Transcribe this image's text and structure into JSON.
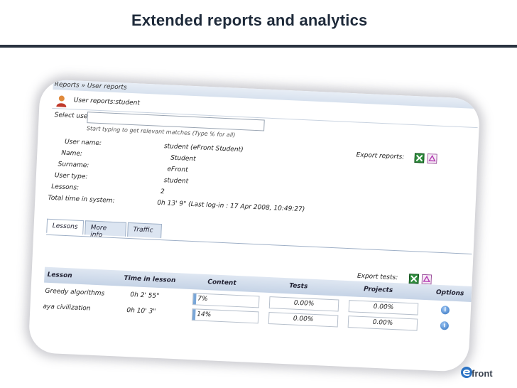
{
  "slide": {
    "title": "Extended reports and analytics"
  },
  "crumb": "Reports » User reports",
  "heading": "User reports:student",
  "select_user": {
    "label": "Select user:",
    "placeholder": "",
    "hint": "Start typing to get relevant matches (Type % for all)"
  },
  "export_reports_label": "Export reports:",
  "info": [
    {
      "label": "User name:",
      "value": "student (eFront Student)"
    },
    {
      "label": "Name:",
      "value": "Student"
    },
    {
      "label": "Surname:",
      "value": "eFront"
    },
    {
      "label": "User type:",
      "value": "student"
    },
    {
      "label": "Lessons:",
      "value": "2"
    },
    {
      "label": "Total time in system:",
      "value": "0h 13' 9\" (Last log-in : 17 Apr 2008, 10:49:27)"
    }
  ],
  "tabs": [
    "Lessons",
    "More info",
    "Traffic"
  ],
  "export_tests_label": "Export tests:",
  "table": {
    "columns": [
      "Lesson",
      "Time in lesson",
      "Content",
      "Tests",
      "Projects",
      "Options"
    ],
    "rows": [
      {
        "lesson": "Greedy algorithms",
        "time": "0h 2' 55\"",
        "content": "7%",
        "tests": "0.00%",
        "projects": "0.00%"
      },
      {
        "lesson": "aya civilization",
        "time": "0h 10' 3\"",
        "content": "14%",
        "tests": "0.00%",
        "projects": "0.00%"
      }
    ]
  },
  "logo": "front",
  "colors": {
    "title": "#1e2a3a",
    "excel_green": "#1f7a2e",
    "tab_bg": "#dce5f1",
    "header_bg": "#c5d3e6"
  }
}
